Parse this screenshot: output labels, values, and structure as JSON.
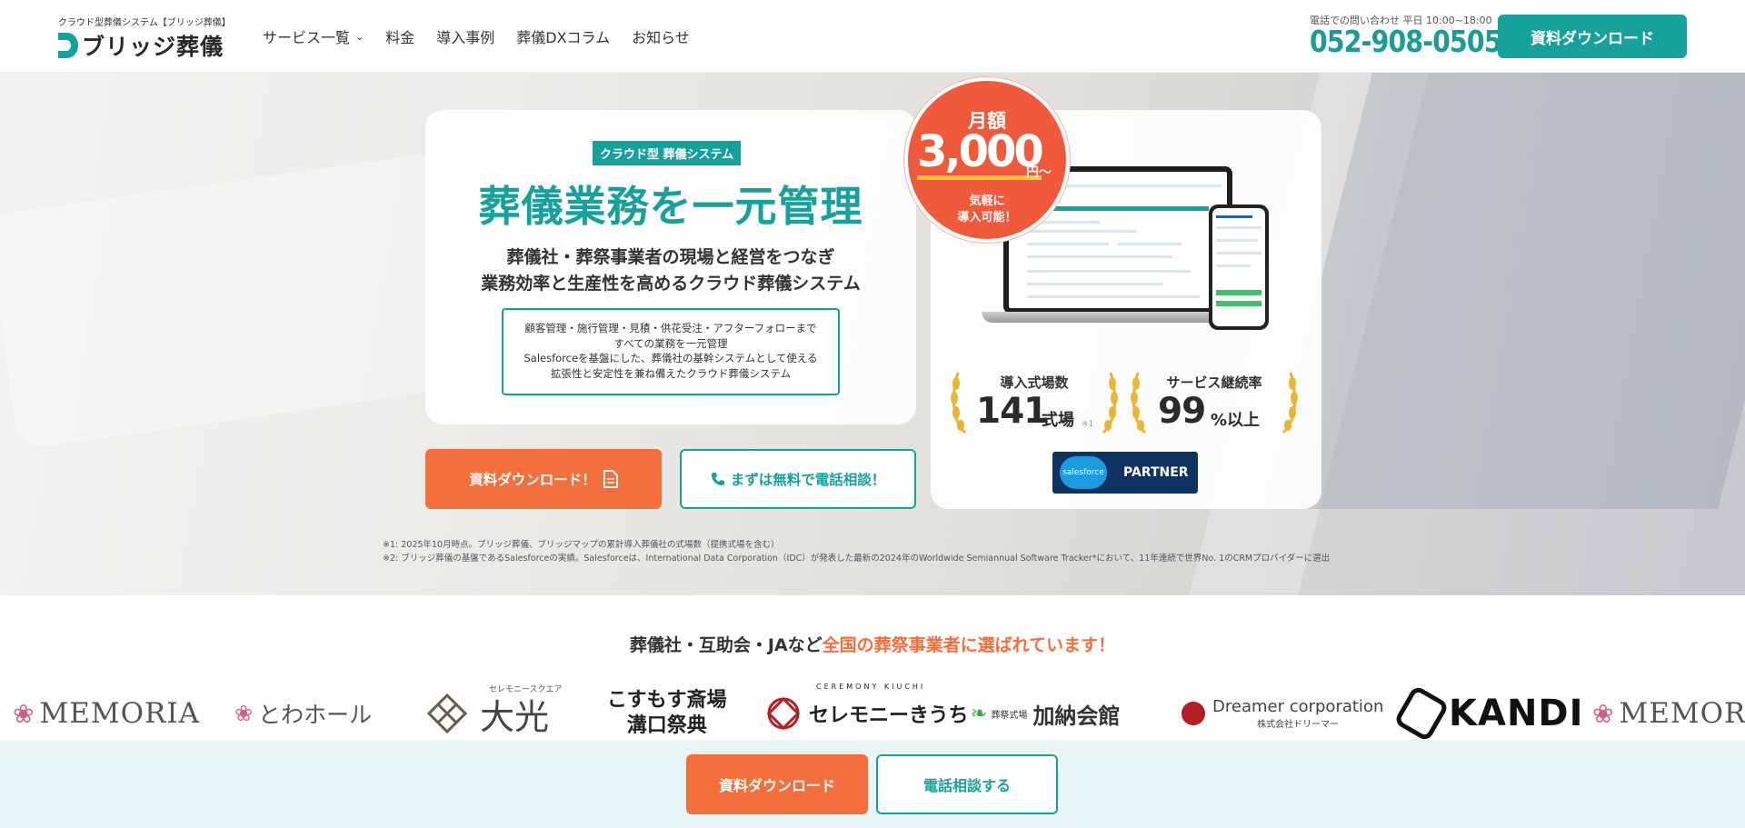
{
  "header": {
    "logo_sub": "クラウド型葬儀システム【ブリッジ葬儀】",
    "logo_text": "ブリッジ葬儀",
    "nav": [
      {
        "label": "サービス一覧",
        "has_dropdown": true
      },
      {
        "label": "料金"
      },
      {
        "label": "導入事例"
      },
      {
        "label": "葬儀DXコラム"
      },
      {
        "label": "お知らせ"
      }
    ],
    "contact_label": "電話での問い合わせ 平日 10:00~18:00",
    "phone": "052-908-0505",
    "download_button": "資料ダウンロード"
  },
  "hero": {
    "tag": "クラウド型 葬儀システム",
    "title": "葬儀業務を一元管理",
    "subtitle_line1": "葬儀社・葬祭事業者の現場と経営をつなぎ",
    "subtitle_line2": "業務効率と生産性を高めるクラウド葬儀システム",
    "desc_line1": "顧客管理・施行管理・見積・供花受注・アフターフォローまで",
    "desc_line2": "すべての業務を一元管理",
    "desc_line3": "Salesforceを基盤にした、葬儀社の基幹システムとして使える",
    "desc_line4": "拡張性と安定性を兼ね備えたクラウド葬儀システム",
    "badge": {
      "monthly": "月額",
      "price": "3,000",
      "yen": "円〜",
      "note_line1": "気軽に",
      "note_line2": "導入可能！"
    },
    "stats": [
      {
        "label": "導入式場数",
        "value": "141",
        "unit": "式場",
        "note": "※1"
      },
      {
        "label": "サービス継続率",
        "value": "99",
        "unit": "%以上",
        "note": ""
      }
    ],
    "salesforce_logo": "salesforce",
    "partner_label": "PARTNER",
    "cta_download": "資料ダウンロード！",
    "cta_tel": "まずは無料で電話相談！",
    "note1": "※1: 2025年10月時点。ブリッジ葬儀、ブリッジマップの累計導入葬儀社の式場数（提携式場を含む）",
    "note2": "※2: ブリッジ葬儀の基盤であるSalesforceの実績。Salesforceは、International Data Corporation（IDC）が発表した最新の2024年のWorldwide Semiannual Software Tracker*において、11年連続で世界No. 1のCRMプロバイダーに選出"
  },
  "clients": {
    "title_plain": "葬儀社・互助会・JAなど",
    "title_accent": "全国の葬祭事業者に選ばれています！",
    "logos": {
      "memoria": "MEMORIA",
      "memoria_small": "MEMORIA",
      "towa": "とわホール",
      "taiko_sub": "セレモニースクエア",
      "taiko": "大光",
      "kosumosu_line1": "こすもす斎場",
      "kosumosu_line2": "溝口祭典",
      "kiuchi_sub": "CEREMONY KIUCHI",
      "kiuchi": "セレモニーきうち",
      "kanou_sub": "葬祭式場",
      "kanou": "加納会館",
      "dreamer": "Dreamer corporation",
      "dreamer_sub": "株式会社ドリーマー",
      "kandi": "KANDI",
      "memoria2": "MEMORIA"
    }
  },
  "sticky": {
    "download": "資料ダウンロード",
    "tel": "電話相談する"
  },
  "colors": {
    "teal": "#16a19d",
    "orange": "#f36f3b",
    "badge_red": "#ef5a3b",
    "gold": "#e9b632",
    "salesforce_navy": "#0f3360"
  }
}
